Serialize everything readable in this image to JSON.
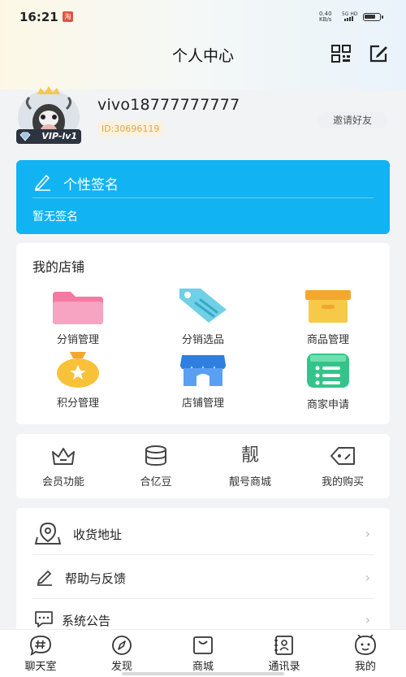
{
  "status_bar": {
    "time": "16:21",
    "net_speed": "0.40",
    "net_unit": "KB/s",
    "signal_label": "5G HD",
    "app_badge": "淘"
  },
  "header": {
    "title": "个人中心"
  },
  "profile": {
    "username": "vivo18777777777",
    "user_id": "ID:30696119",
    "vip_badge": "VIP-lv1",
    "invite_label": "邀请好友"
  },
  "signature": {
    "title": "个性签名",
    "text": "暂无签名"
  },
  "shop": {
    "title": "我的店铺",
    "items": [
      {
        "label": "分销管理",
        "icon": "folder-icon"
      },
      {
        "label": "分销选品",
        "icon": "tag-icon"
      },
      {
        "label": "商品管理",
        "icon": "box-icon"
      },
      {
        "label": "积分管理",
        "icon": "money-bag-icon"
      },
      {
        "label": "店铺管理",
        "icon": "store-icon"
      },
      {
        "label": "商家申请",
        "icon": "list-icon"
      }
    ]
  },
  "features": {
    "items": [
      {
        "label": "会员功能",
        "icon": "crown-icon"
      },
      {
        "label": "合亿豆",
        "icon": "coins-icon"
      },
      {
        "label": "靓号商城",
        "glyph": "靓",
        "icon": "liang-glyph-icon"
      },
      {
        "label": "我的购买",
        "icon": "price-tag-icon"
      }
    ]
  },
  "menu": {
    "items": [
      {
        "label": "收货地址",
        "icon": "location-icon"
      },
      {
        "label": "帮助与反馈",
        "icon": "feedback-pen-icon"
      },
      {
        "label": "系统公告",
        "icon": "message-icon"
      }
    ],
    "chevron": "›"
  },
  "bottom_nav": {
    "items": [
      {
        "label": "聊天室",
        "icon": "chat-hash-icon"
      },
      {
        "label": "发现",
        "icon": "compass-icon"
      },
      {
        "label": "商城",
        "icon": "shop-bag-icon"
      },
      {
        "label": "通讯录",
        "icon": "contacts-icon"
      },
      {
        "label": "我的",
        "icon": "profile-face-icon"
      }
    ]
  },
  "colors": {
    "accent_blue": "#12b3f2",
    "id_gold": "#d8a94c"
  }
}
